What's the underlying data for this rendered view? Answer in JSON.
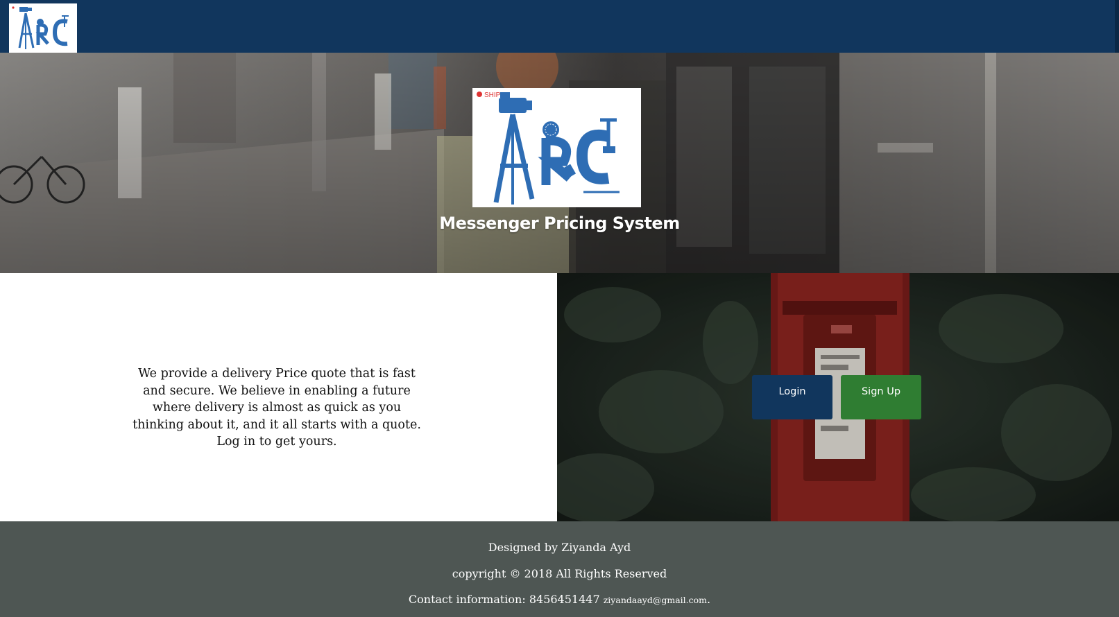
{
  "header": {
    "logo_alt": "ARC"
  },
  "hero": {
    "logo_ship_text": "SHIP",
    "logo_text": "ARC",
    "title": "Messenger Pricing System"
  },
  "main": {
    "tagline": "We provide a delivery Price quote that is fast and secure. We believe in enabling a future where delivery is almost as quick as you thinking about it, and it all starts with a quote. Log in to get yours.",
    "login_label": "Login",
    "signup_label": "Sign Up"
  },
  "footer": {
    "designed_by": "Designed by Ziyanda Ayd",
    "copyright": "copyright © 2018 All Rights Reserved",
    "contact_label": "Contact information: 8456451447",
    "email": "ziyandaayd@gmail.com",
    "email_suffix": "."
  },
  "colors": {
    "navbar": "#11365d",
    "login_button": "#11365d",
    "signup_button": "#2f7d32",
    "footer": "#4e5653",
    "logo_blue": "#2e6db4"
  }
}
